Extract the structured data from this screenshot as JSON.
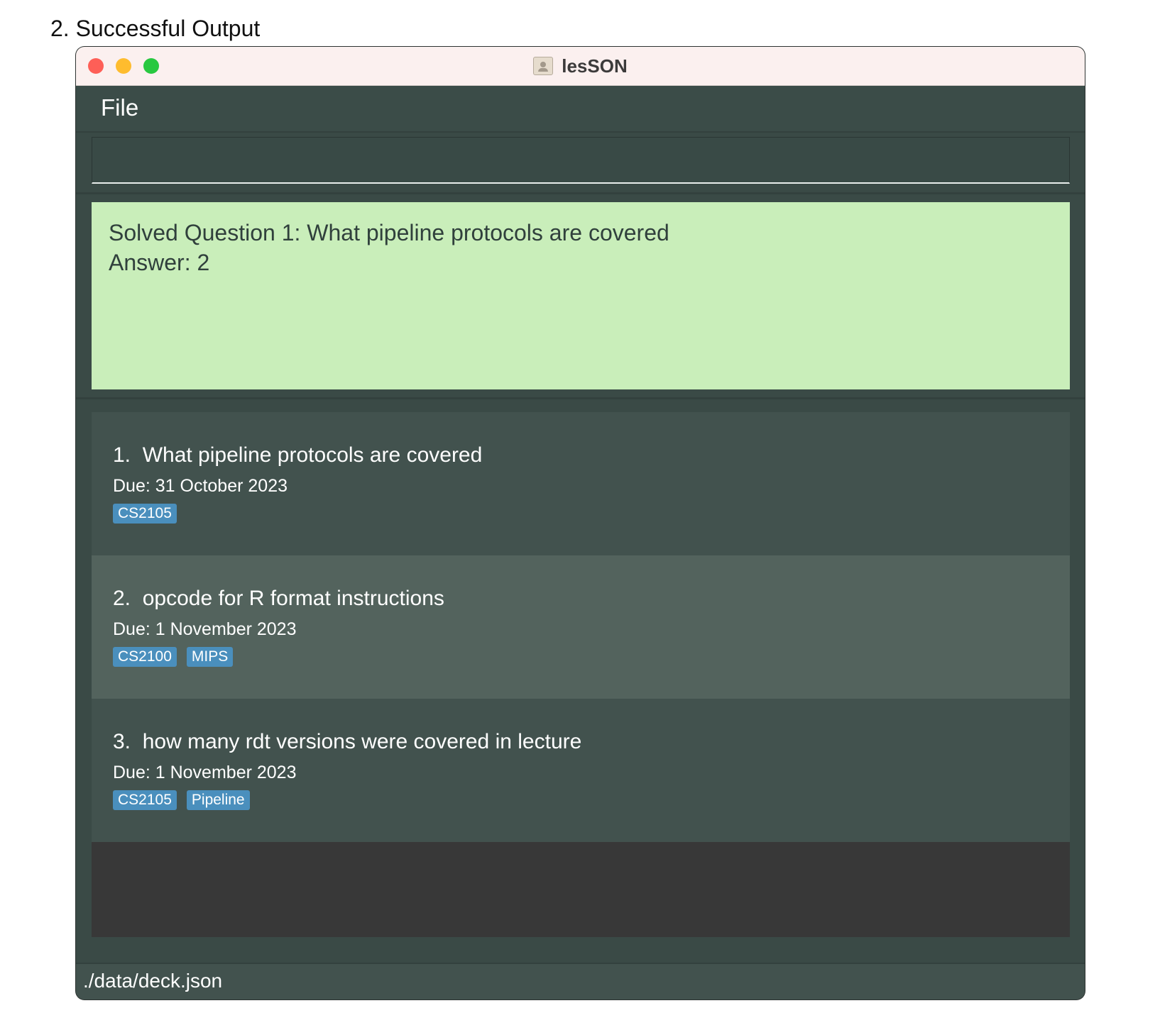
{
  "caption": "2. Successful Output",
  "window": {
    "title": "lesSON",
    "icon": "document-person-icon"
  },
  "menu": {
    "file_label": "File"
  },
  "command": {
    "value": "",
    "placeholder": ""
  },
  "result": {
    "line1": "Solved Question 1: What pipeline protocols are covered",
    "line2": "Answer: 2",
    "background_color": "#c9eeba"
  },
  "cards": [
    {
      "index": "1.",
      "question": "What pipeline protocols are covered",
      "due": "Due: 31 October 2023",
      "tags": [
        "CS2105"
      ]
    },
    {
      "index": "2.",
      "question": "opcode for R format instructions",
      "due": "Due: 1 November 2023",
      "tags": [
        "CS2100",
        "MIPS"
      ]
    },
    {
      "index": "3.",
      "question": "how many rdt versions were covered in lecture",
      "due": "Due: 1 November 2023",
      "tags": [
        "CS2105",
        "Pipeline"
      ]
    }
  ],
  "status": {
    "path": "./data/deck.json"
  },
  "colors": {
    "tag": "#4a8fbd",
    "card_odd": "#42524e",
    "card_even": "#53635d"
  }
}
